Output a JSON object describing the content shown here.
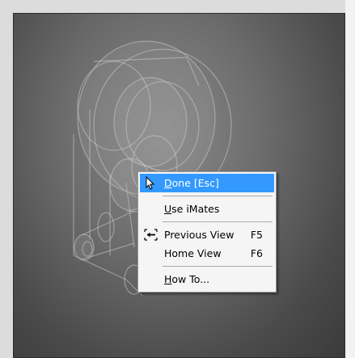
{
  "context_menu": {
    "items": [
      {
        "prefix": "D",
        "rest": "one [Esc]",
        "shortcut": "",
        "icon": "select-arrow-icon"
      },
      {
        "prefix": "U",
        "rest": "se iMates",
        "shortcut": "",
        "icon": ""
      },
      {
        "prefix": "",
        "rest": "Previous View",
        "shortcut": "F5",
        "icon": "previous-view-icon"
      },
      {
        "prefix": "",
        "rest": "Home View",
        "shortcut": "F6",
        "icon": ""
      },
      {
        "prefix": "H",
        "rest": "ow To...",
        "shortcut": "",
        "icon": ""
      }
    ]
  },
  "colors": {
    "highlight": "#3399ff",
    "menu_background": "#f5f5f5",
    "viewport_dark": "#3a3a3a"
  }
}
